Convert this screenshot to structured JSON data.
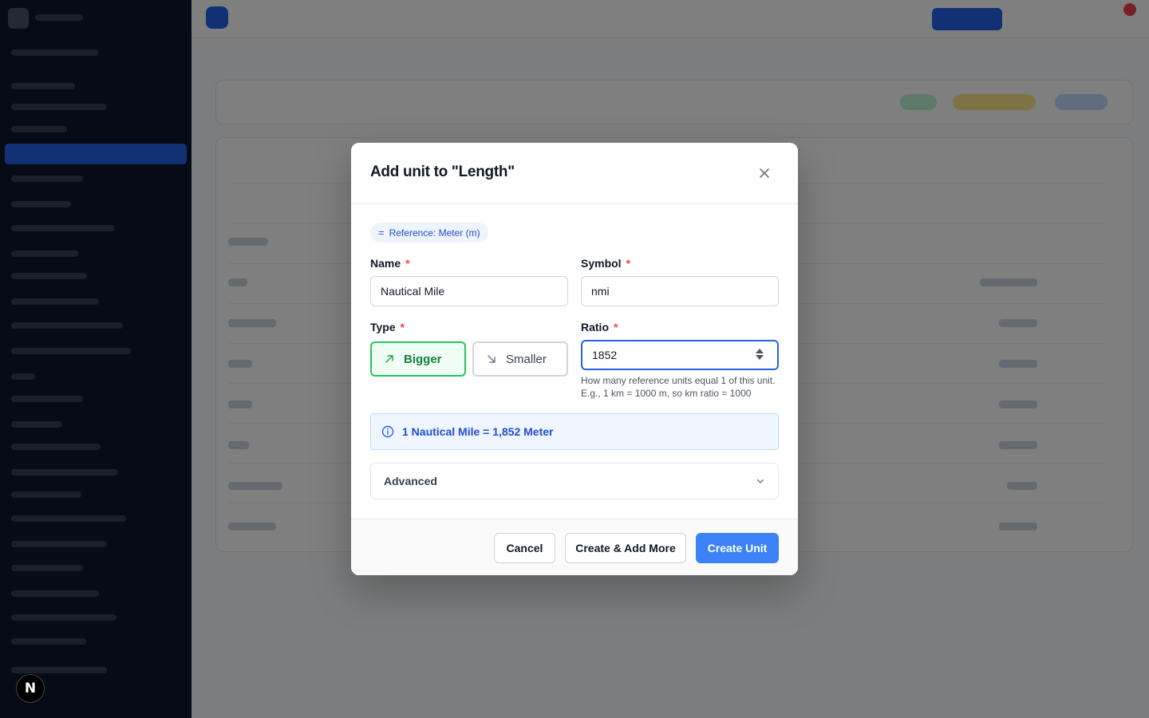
{
  "modal": {
    "title": "Add unit to \"Length\"",
    "reference_chip": "Reference: Meter (m)",
    "name_label": "Name",
    "name_value": "Nautical Mile",
    "symbol_label": "Symbol",
    "symbol_value": "nmi",
    "type_label": "Type",
    "type_options": [
      {
        "label": "Bigger",
        "icon": "arrow-up-right-icon",
        "selected": true
      },
      {
        "label": "Smaller",
        "icon": "arrow-down-right-icon",
        "selected": false
      }
    ],
    "ratio_label": "Ratio",
    "ratio_value": "1852",
    "ratio_hint": "How many reference units equal 1 of this unit. E.g., 1 km = 1000 m, so km ratio = 1000",
    "required_marker": "*",
    "conversion_info": "1 Nautical Mile = 1,852 Meter",
    "advanced_label": "Advanced",
    "buttons": {
      "cancel": "Cancel",
      "create_add_more": "Create & Add More",
      "create": "Create Unit"
    }
  },
  "dev_badge": "N",
  "colors": {
    "primary": "#3b82f6",
    "selected_green": "#22c55e",
    "info_blue": "#1d4ed8",
    "required_red": "#ef4444",
    "sidebar": "#0f172a"
  }
}
